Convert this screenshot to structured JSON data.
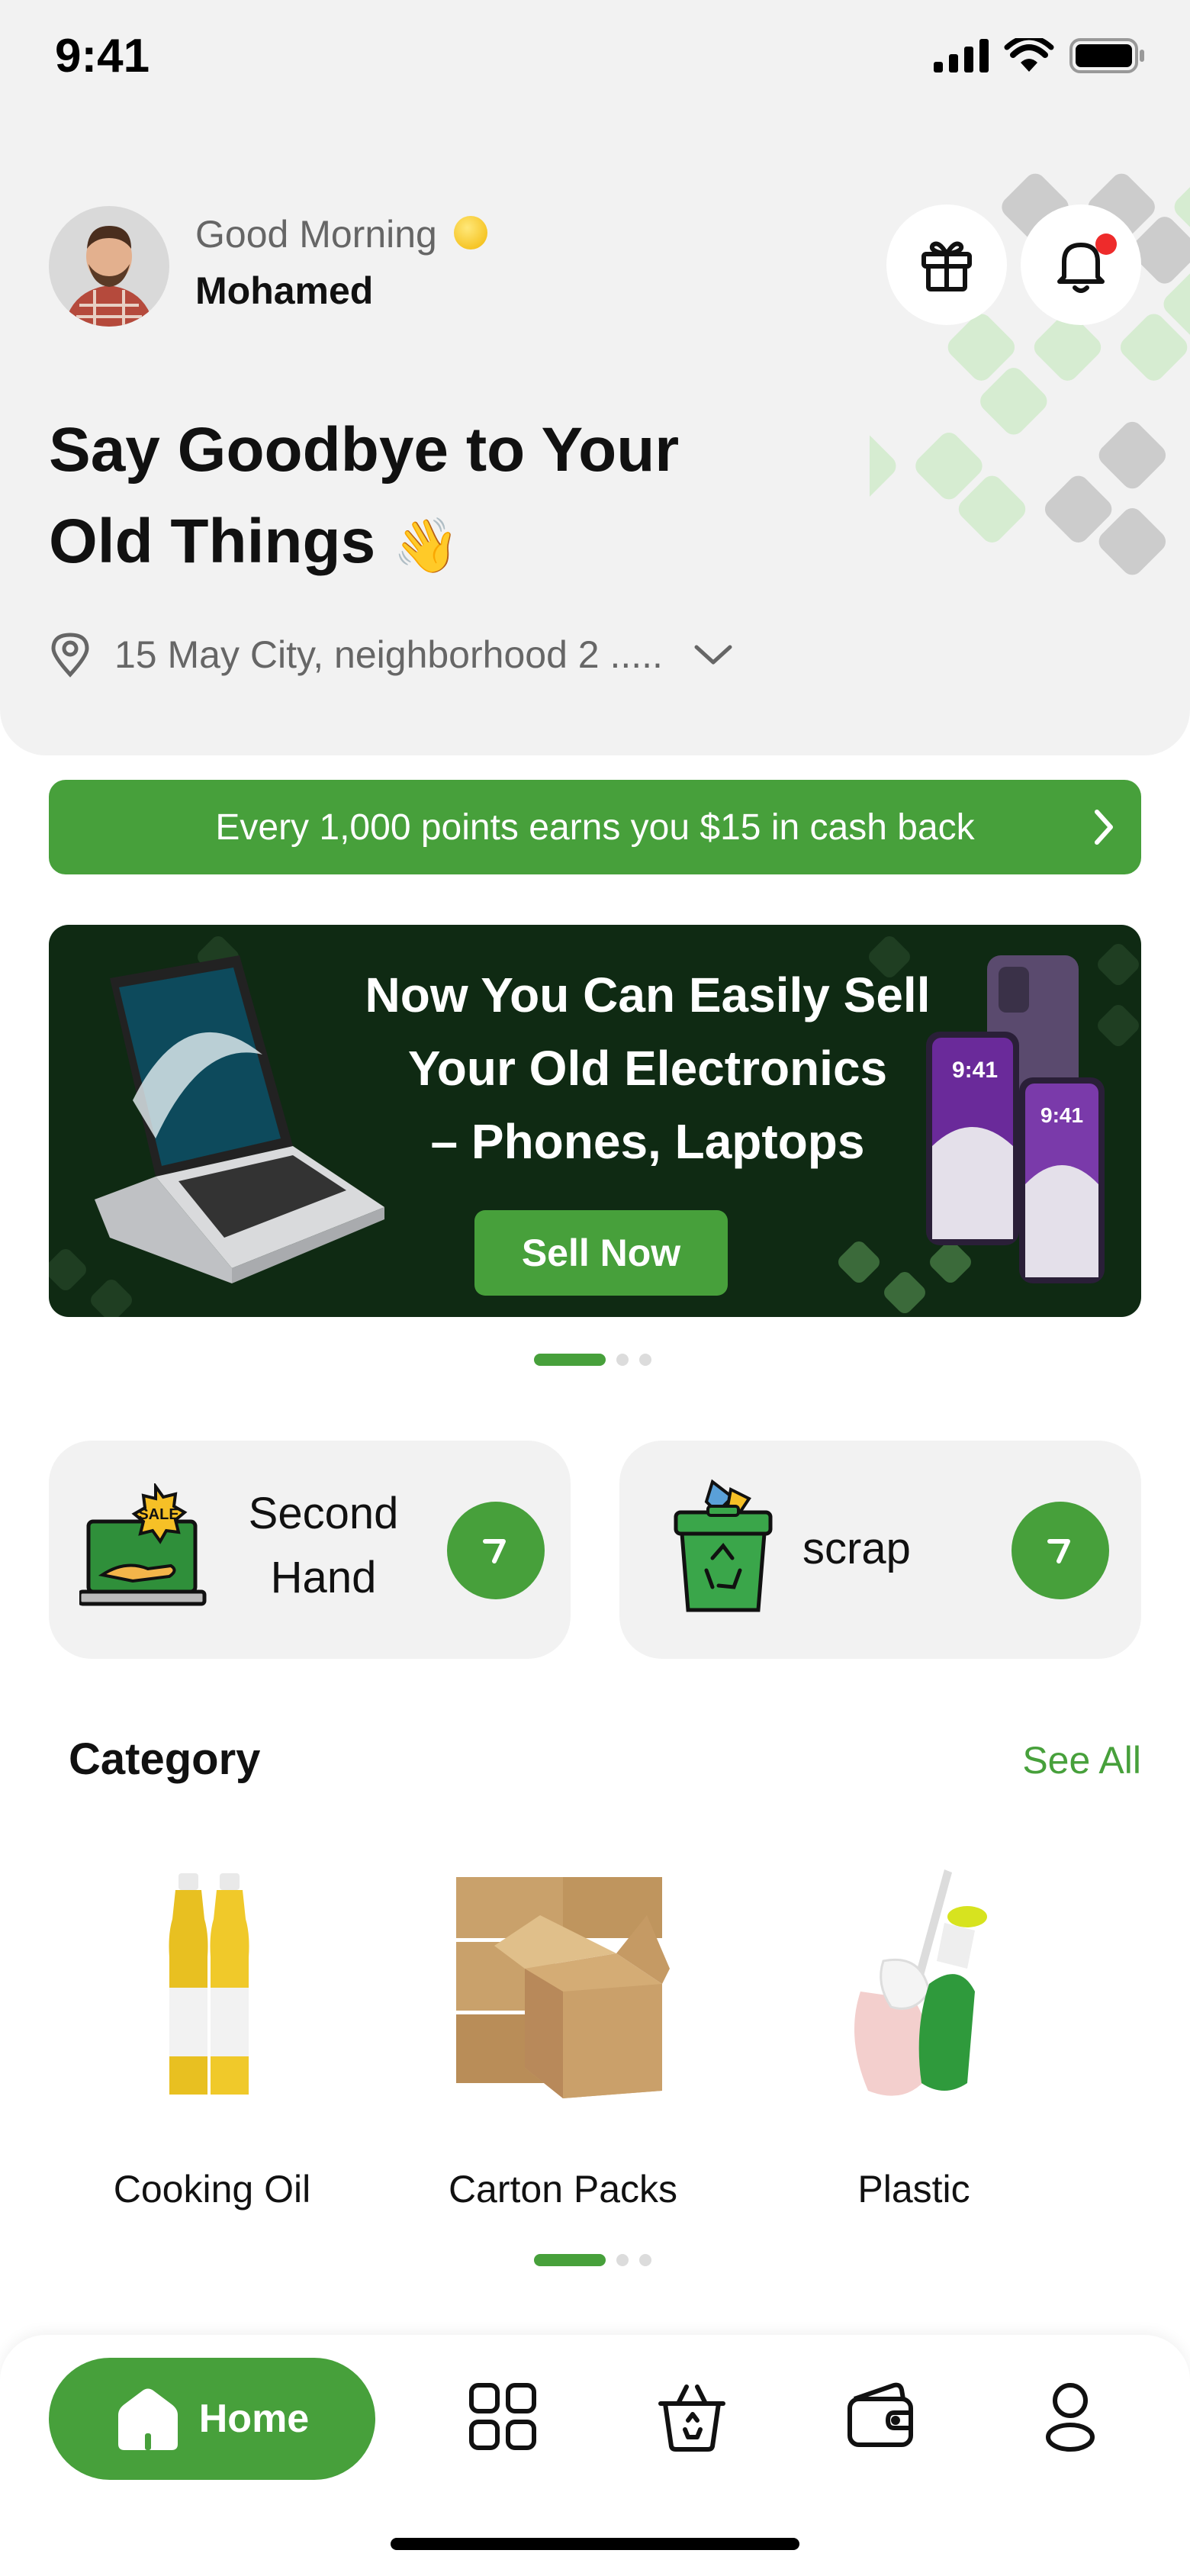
{
  "status_bar": {
    "time": "9:41"
  },
  "header": {
    "greeting": "Good Morning",
    "user_name": "Mohamed",
    "title": "Say Goodbye to Your Old Things",
    "location": "15 May City, neighborhood 2 .....",
    "icons": [
      "gift-icon",
      "bell-icon",
      "location-pin-icon",
      "chevron-down-icon"
    ]
  },
  "points_banner": {
    "text": "Every 1,000 points earns you $15 in cash back"
  },
  "promo": {
    "title_line1": "Now You Can Easily Sell",
    "title_line2": "Your Old Electronics",
    "title_line3": "– Phones, Laptops",
    "button_label": "Sell Now",
    "phone_time": "9:41"
  },
  "quick_actions": [
    {
      "line1": "Second",
      "line2": "Hand",
      "icon": "sale-laptop-icon"
    },
    {
      "label": "scrap",
      "icon": "recycle-bin-icon"
    }
  ],
  "category": {
    "title": "Category",
    "see_all": "See All",
    "items": [
      {
        "label": "Cooking Oil"
      },
      {
        "label": "Carton Packs"
      },
      {
        "label": "Plastic"
      }
    ]
  },
  "tabbar": {
    "home_label": "Home",
    "icons": [
      "home-icon",
      "grid-icon",
      "recycle-basket-icon",
      "wallet-icon",
      "profile-icon"
    ]
  },
  "colors": {
    "primary": "#47a03b",
    "promo_bg": "#0f2a13",
    "hero_bg": "#f2f2f2",
    "notification": "#ee2b2b"
  }
}
